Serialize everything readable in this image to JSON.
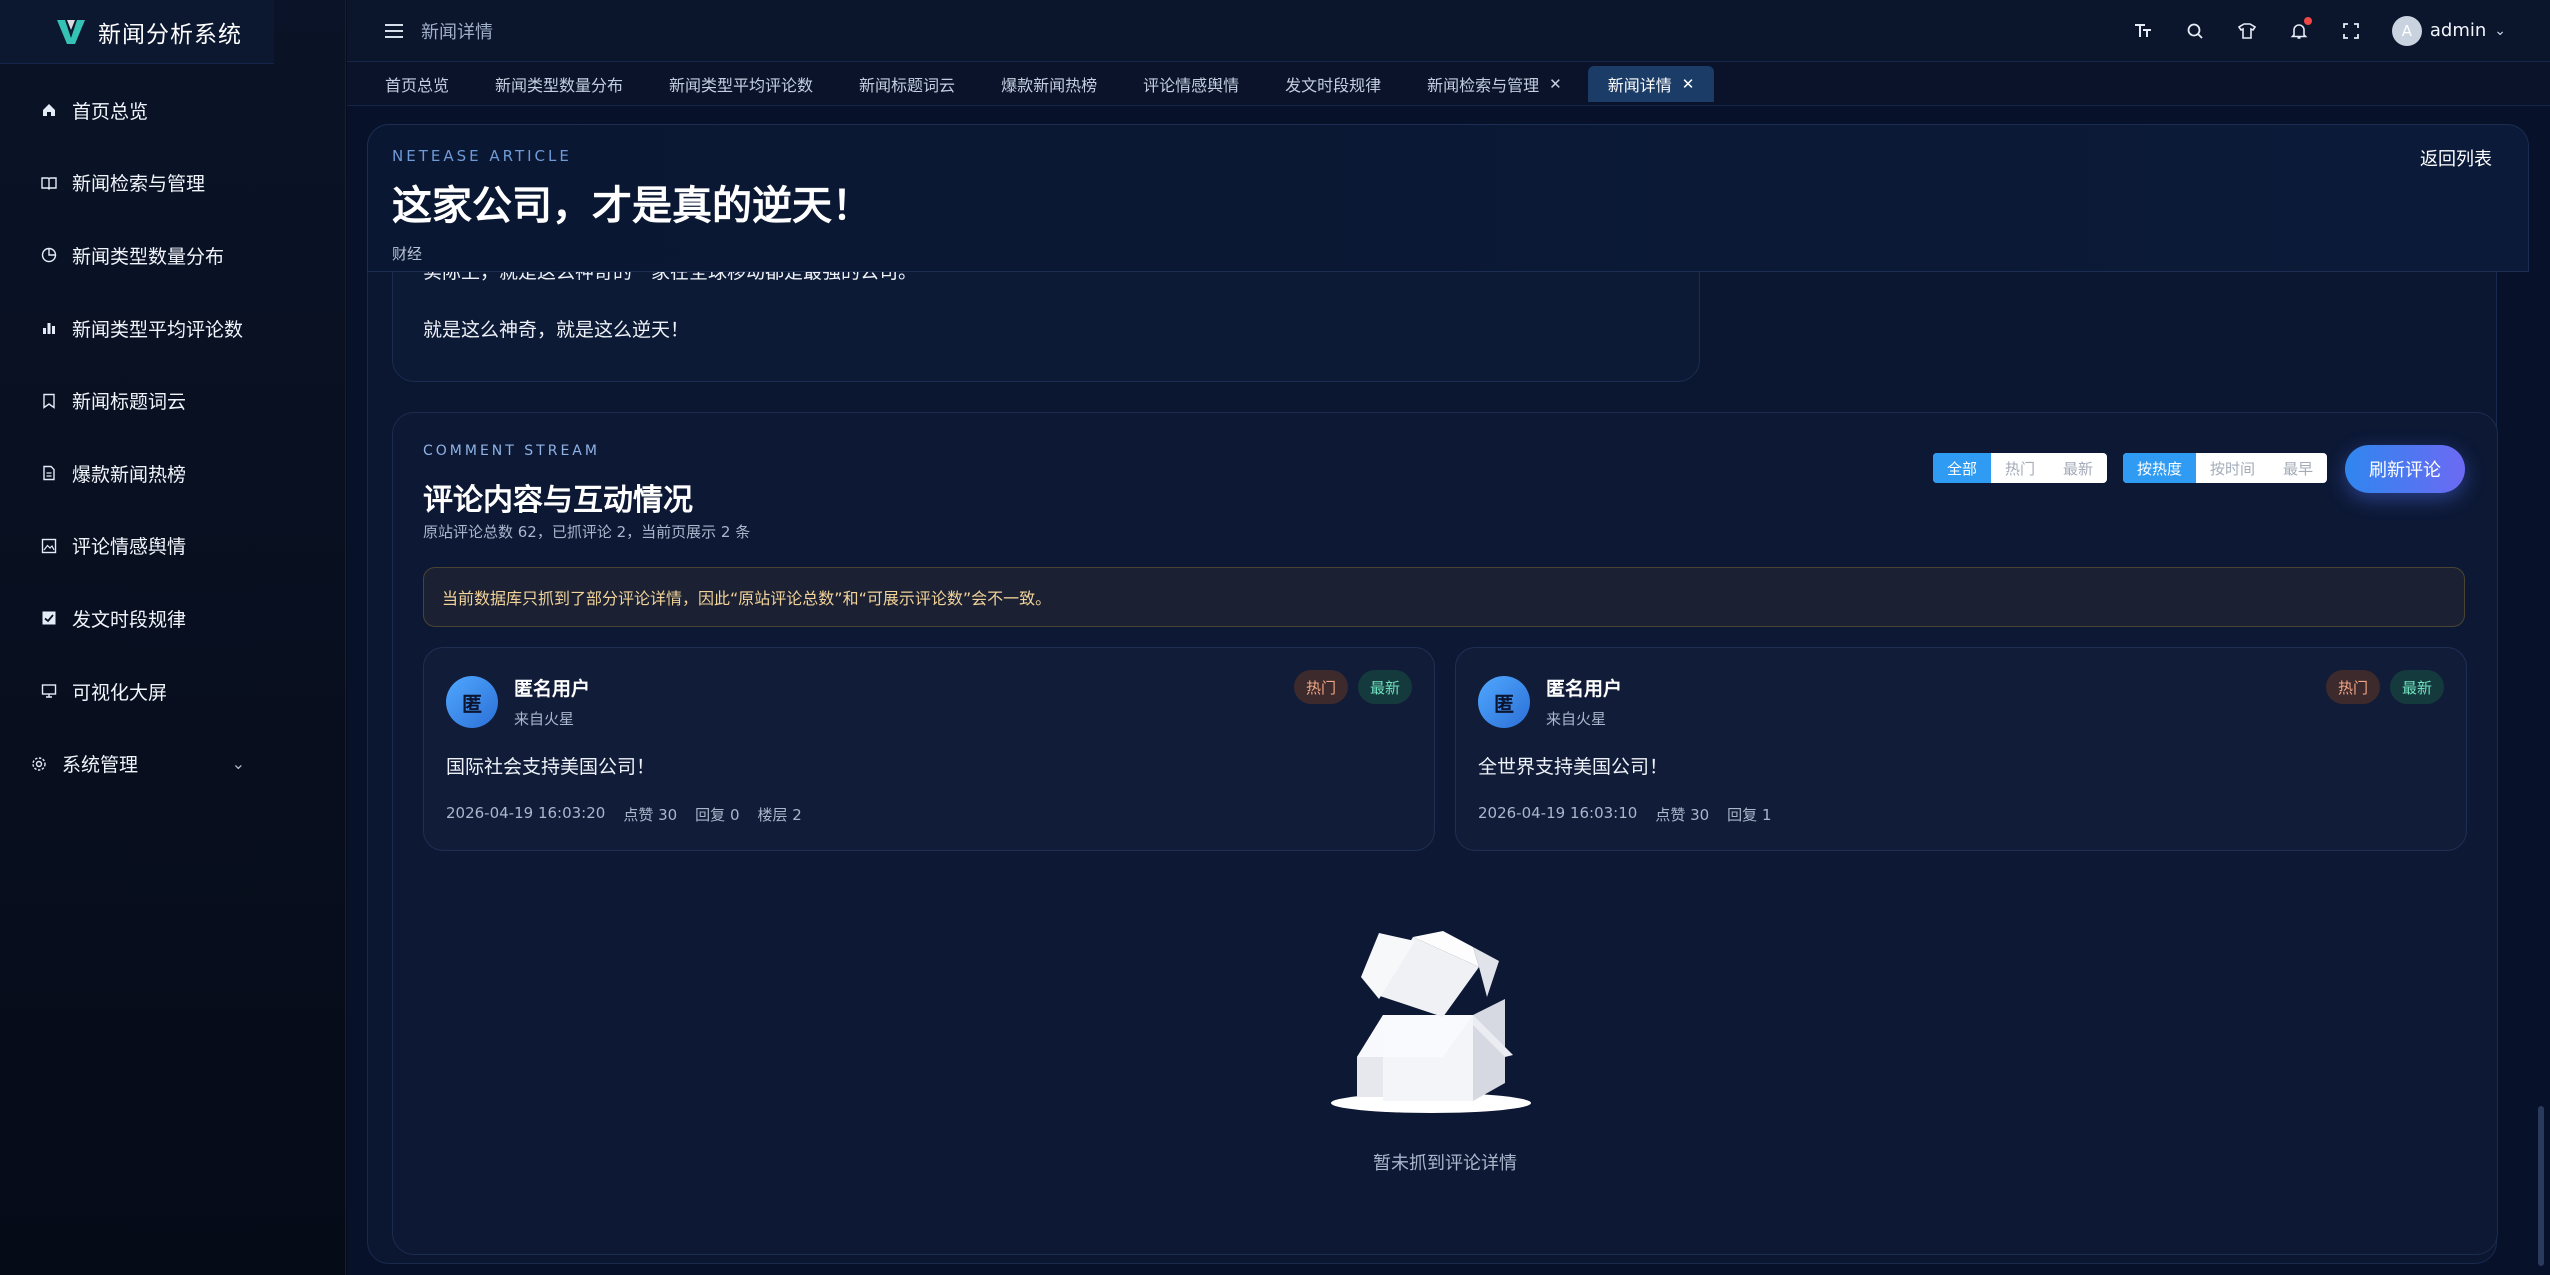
{
  "app": {
    "name": "新闻分析系统"
  },
  "sidebar": {
    "items": [
      {
        "label": "首页总览"
      },
      {
        "label": "新闻检索与管理"
      },
      {
        "label": "新闻类型数量分布"
      },
      {
        "label": "新闻类型平均评论数"
      },
      {
        "label": "新闻标题词云"
      },
      {
        "label": "爆款新闻热榜"
      },
      {
        "label": "评论情感舆情"
      },
      {
        "label": "发文时段规律"
      },
      {
        "label": "可视化大屏"
      },
      {
        "label": "系统管理"
      }
    ]
  },
  "topbar": {
    "crumb": "新闻详情",
    "user": "admin",
    "avatar_letter": "A"
  },
  "tabs": [
    {
      "label": "首页总览"
    },
    {
      "label": "新闻类型数量分布"
    },
    {
      "label": "新闻类型平均评论数"
    },
    {
      "label": "新闻标题词云"
    },
    {
      "label": "爆款新闻热榜"
    },
    {
      "label": "评论情感舆情"
    },
    {
      "label": "发文时段规律"
    },
    {
      "label": "新闻检索与管理"
    },
    {
      "label": "新闻详情"
    }
  ],
  "article": {
    "kicker": "NETEASE ARTICLE",
    "title": "这家公司，才是真的逆天！",
    "category": "财经",
    "back": "返回列表",
    "body_lines": [
      "实际上，就是这么神奇的一家在全球移动都是最强的公司。",
      "就是这么神奇，就是这么逆天！"
    ]
  },
  "comments": {
    "kicker": "COMMENT STREAM",
    "title": "评论内容与互动情况",
    "summary": "原站评论总数 62，已抓评论 2，当前页展示 2 条",
    "filter": [
      "全部",
      "热门",
      "最新"
    ],
    "sort": [
      "按热度",
      "按时间",
      "最早"
    ],
    "refresh": "刷新评论",
    "notice": "当前数据库只抓到了部分评论详情，因此“原站评论总数”和“可展示评论数”会不一致。",
    "items": [
      {
        "avatar": "匿",
        "name": "匿名用户",
        "from": "来自火星",
        "tag_hot": "热门",
        "tag_new": "最新",
        "text": "国际社会支持美国公司！",
        "time": "2026-04-19 16:03:20",
        "likes": "点赞 30",
        "replies": "回复 0",
        "floor": "楼层 2"
      },
      {
        "avatar": "匿",
        "name": "匿名用户",
        "from": "来自火星",
        "tag_hot": "热门",
        "tag_new": "最新",
        "text": "全世界支持美国公司！",
        "time": "2026-04-19 16:03:10",
        "likes": "点赞 30",
        "replies": "回复 1"
      }
    ],
    "empty_text": "暂未抓到评论详情"
  },
  "colors": {
    "accent": "#2f9bf2",
    "bg": "#070d1c",
    "hot": "#f1a585",
    "new": "#6fe0be"
  }
}
